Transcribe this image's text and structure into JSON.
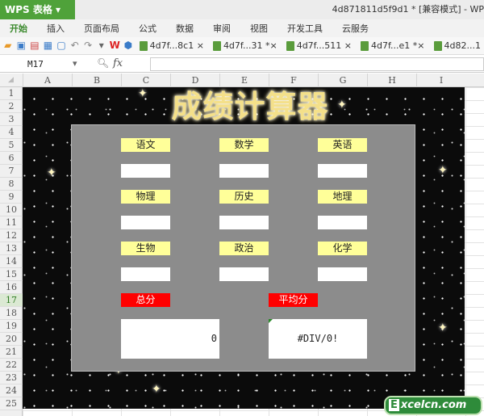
{
  "app": {
    "name": "WPS 表格",
    "doc_title": "4d871811d5f9d1 * [兼容模式] - WP"
  },
  "menu": [
    "开始",
    "插入",
    "页面布局",
    "公式",
    "数据",
    "审阅",
    "视图",
    "开发工具",
    "云服务"
  ],
  "tabs": [
    "4d7f...8c1 ×",
    "4d7f...31 *×",
    "4d7f...511 ×",
    "4d7f...e1 *×",
    "4d82...1"
  ],
  "formula_bar": {
    "name_box": "M17",
    "fx": "fx",
    "value": ""
  },
  "columns": [
    "A",
    "B",
    "C",
    "D",
    "E",
    "F",
    "G",
    "H",
    "I"
  ],
  "rows": [
    "1",
    "2",
    "3",
    "4",
    "5",
    "6",
    "7",
    "8",
    "9",
    "10",
    "11",
    "12",
    "13",
    "14",
    "15",
    "16",
    "17",
    "18",
    "19",
    "20",
    "21",
    "22",
    "23",
    "24",
    "25"
  ],
  "selected_row": "17",
  "sheet": {
    "title": "成绩计算器",
    "subjects": [
      "语文",
      "数学",
      "英语",
      "物理",
      "历史",
      "地理",
      "生物",
      "政治",
      "化学"
    ],
    "total_label": "总分",
    "average_label": "平均分",
    "total_value": "0",
    "average_value": "#DIV/0!"
  },
  "watermark": "Excelcn.com"
}
